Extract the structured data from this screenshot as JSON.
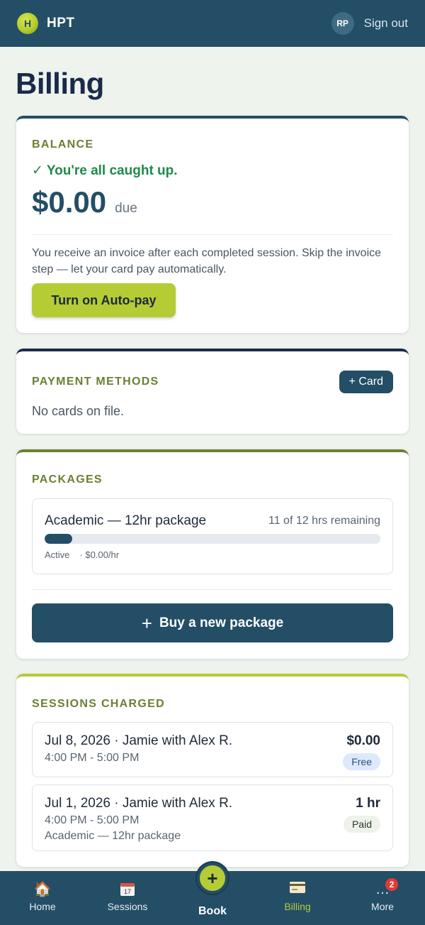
{
  "header": {
    "logo_text": "H",
    "app_name": "HPT",
    "user_initials": "RP",
    "sign_out_label": "Sign out"
  },
  "page": {
    "title": "Billing"
  },
  "balance": {
    "label": "BALANCE",
    "status": "✓ You're all caught up.",
    "amount": "$0.00",
    "amount_suffix": "due",
    "autopay_text": "You receive an invoice after each completed session. Skip the invoice step — let your card pay automatically.",
    "autopay_button": "Turn on Auto-pay"
  },
  "payment_methods": {
    "label": "PAYMENT METHODS",
    "add_card_button": "+ Card",
    "empty_text": "No cards on file."
  },
  "packages": {
    "label": "PACKAGES",
    "items": [
      {
        "name": "Academic — 12hr package",
        "remaining": "11 of 12 hrs remaining",
        "progress_fraction": 0.0833,
        "status": "Active",
        "rate": "· $0.00/hr"
      }
    ],
    "buy_button": "Buy a new package"
  },
  "sessions_charged": {
    "label": "SESSIONS CHARGED",
    "items": [
      {
        "title": "Jul 8, 2026 · Jamie with Alex R.",
        "time": "4:00 PM - 5:00 PM",
        "package": "",
        "amount": "$0.00",
        "badge": "Free"
      },
      {
        "title": "Jul 1, 2026 · Jamie with Alex R.",
        "time": "4:00 PM - 5:00 PM",
        "package": "Academic — 12hr package",
        "amount": "1 hr",
        "badge": "Paid"
      }
    ]
  },
  "bottom_nav": {
    "items": [
      {
        "label": "Home",
        "icon": "home-icon"
      },
      {
        "label": "Sessions",
        "icon": "calendar-icon",
        "icon_text": "17"
      },
      {
        "label": "Book",
        "icon": "plus-icon"
      },
      {
        "label": "Billing",
        "icon": "credit-card-icon",
        "active": true
      },
      {
        "label": "More",
        "icon": "more-icon",
        "badge": "2"
      }
    ]
  },
  "colors": {
    "primary": "#234e66",
    "accent": "#b5cc35",
    "success": "#1e8a4a",
    "section_label": "#6b7f34"
  }
}
